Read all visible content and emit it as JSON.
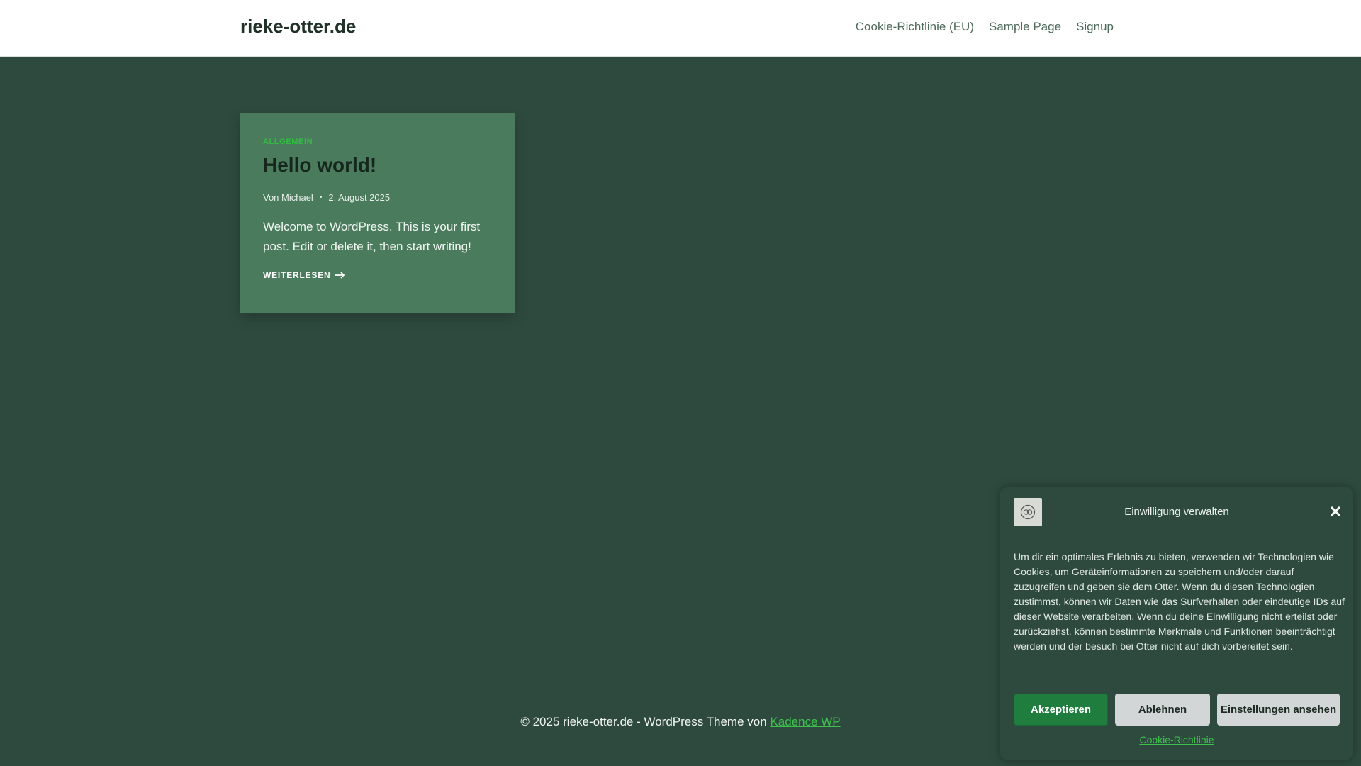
{
  "header": {
    "site_title": "rieke-otter.de",
    "nav": [
      {
        "label": "Cookie-Richtlinie (EU)"
      },
      {
        "label": "Sample Page"
      },
      {
        "label": "Signup"
      }
    ]
  },
  "post": {
    "category": "ALLGEMEIN",
    "title": "Hello world!",
    "author": "Von Michael",
    "meta_separator": "•",
    "date": "2. August 2025",
    "excerpt": "Welcome to WordPress. This is your first post. Edit or delete it, then start writing!",
    "read_more": "WEITERLESEN",
    "read_more_icon": "arrow-right-icon"
  },
  "footer": {
    "text": "© 2025 rieke-otter.de - WordPress Theme von",
    "link": "Kadence WP"
  },
  "cookie_banner": {
    "logo_icon": "ro-logo-icon",
    "title": "Einwilligung verwalten",
    "close_icon": "close-icon",
    "message": "Um dir ein optimales Erlebnis zu bieten, verwenden wir Technologien wie Cookies, um Geräteinformationen zu speichern und/oder darauf zuzugreifen und geben sie dem Otter. Wenn du diesen Technologien zustimmst, können wir Daten wie das Surfverhalten oder eindeutige IDs auf dieser Website verarbeiten. Wenn du deine Einwilligung nicht erteilst oder zurückziehst, können bestimmte Merkmale und Funktionen beeinträchtigt werden und der besuch bei Otter nicht auf dich vorbereitet sein.",
    "accept_label": "Akzeptieren",
    "deny_label": "Ablehnen",
    "prefs_label": "Einstellungen ansehen",
    "policy_link": "Cookie-Richtlinie"
  },
  "colors": {
    "page_background": "#2e4a3f",
    "card_background": "#4a7b5d",
    "accent_green": "#3cc24a",
    "accept_button": "#1f7d3e"
  }
}
